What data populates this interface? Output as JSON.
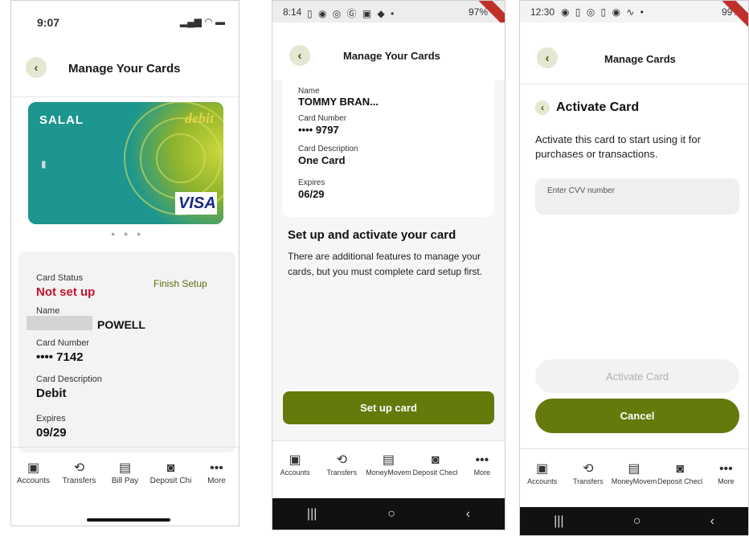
{
  "phone1": {
    "status_time": "9:07",
    "header_title": "Manage Your Cards",
    "card": {
      "brand": "SALAL",
      "type_label": "debit",
      "network": "VISA",
      "chip_glyph": "▮"
    },
    "card_status_label": "Card Status",
    "card_status_value": "Not set up",
    "finish_setup_label": "Finish Setup",
    "name_label": "Name",
    "name_value": "POWELL",
    "card_number_label": "Card Number",
    "card_number_value": "•••• 7142",
    "card_description_label": "Card Description",
    "card_description_value": "Debit",
    "expires_label": "Expires",
    "expires_value": "09/29",
    "nav": [
      {
        "label": "Accounts",
        "icon": "wallet-icon"
      },
      {
        "label": "Transfers",
        "icon": "transfer-icon"
      },
      {
        "label": "Bill Pay",
        "icon": "bill-icon"
      },
      {
        "label": "Deposit Chi",
        "icon": "camera-icon"
      },
      {
        "label": "More",
        "icon": "more-icon"
      }
    ]
  },
  "phone2": {
    "status_time": "8:14",
    "status_right": "97%",
    "header_title": "Manage Your Cards",
    "name_label": "Name",
    "name_value": "TOMMY BRAN...",
    "card_number_label": "Card Number",
    "card_number_value": "•••• 9797",
    "card_description_label": "Card Description",
    "card_description_value": "One Card",
    "expires_label": "Expires",
    "expires_value": "06/29",
    "setup_heading": "Set up and activate your card",
    "setup_body": "There are additional features to manage your cards, but you must complete card setup first.",
    "setup_button": "Set up card",
    "nav": [
      {
        "label": "Accounts",
        "icon": "wallet-icon"
      },
      {
        "label": "Transfers",
        "icon": "transfer-icon"
      },
      {
        "label": "MoneyMovem",
        "icon": "bill-icon"
      },
      {
        "label": "Deposit Checl",
        "icon": "camera-icon"
      },
      {
        "label": "More",
        "icon": "more-icon"
      }
    ],
    "sys": [
      "|||",
      "○",
      "‹"
    ]
  },
  "phone3": {
    "status_time": "12:30",
    "status_right": "99%",
    "header_title": "Manage Cards",
    "section_title": "Activate Card",
    "description": "Activate this card to start using it for purchases or transactions.",
    "cvv_placeholder": "Enter CVV number",
    "activate_button": "Activate Card",
    "cancel_button": "Cancel",
    "nav": [
      {
        "label": "Accounts",
        "icon": "wallet-icon"
      },
      {
        "label": "Transfers",
        "icon": "transfer-icon"
      },
      {
        "label": "MoneyMovem",
        "icon": "bill-icon"
      },
      {
        "label": "Deposit Checl",
        "icon": "camera-icon"
      },
      {
        "label": "More",
        "icon": "more-icon"
      }
    ],
    "sys": [
      "|||",
      "○",
      "‹"
    ]
  },
  "colors": {
    "accent": "#647a0b",
    "status_red": "#c8102e",
    "finish_green": "#5c7010",
    "card_teal": "#1f9a92"
  }
}
